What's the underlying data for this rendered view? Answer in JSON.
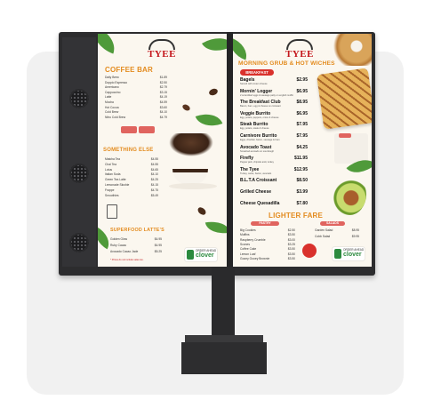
{
  "kiosk": {
    "brand_left": "TYEE",
    "brand_right": "TYEE",
    "left_panel": {
      "coffee_title": "COFFEE BAR",
      "coffee_items": [
        {
          "name": "Daily Brew",
          "price": "$1.89"
        },
        {
          "name": "Doppio Espresso",
          "price": "$2.50"
        },
        {
          "name": "Americano",
          "price": "$2.79"
        },
        {
          "name": "Cappuccino",
          "price": "$3.15"
        },
        {
          "name": "Latte",
          "price": "$4.19"
        },
        {
          "name": "Mocha",
          "price": "$4.59"
        },
        {
          "name": "Hot Cocoa",
          "price": "$3.60"
        },
        {
          "name": "Cold Brew",
          "price": "$4.10"
        },
        {
          "name": "Nitro Cold Brew",
          "price": "$4.79"
        }
      ],
      "else_title": "SOMETHING ELSE",
      "else_items": [
        {
          "name": "Matcha Tea",
          "price": "$4.55"
        },
        {
          "name": "Chai Tea",
          "price": "$4.55"
        },
        {
          "name": "Lotus",
          "price": "$4.65"
        },
        {
          "name": "Italian Soda",
          "price": "$4.10"
        },
        {
          "name": "Green Tea Latte",
          "price": "$4.25"
        },
        {
          "name": "Lemonade Slushie",
          "price": "$4.15"
        },
        {
          "name": "Frappe",
          "price": "$4.75"
        },
        {
          "name": "Smoothies",
          "price": "$5.49"
        }
      ],
      "superfood_title": "SUPERFOOD LATTE'S",
      "superfood_items": [
        {
          "name": "Golden Glow",
          "price": "$4.95"
        },
        {
          "name": "Ruby Cacao",
          "price": "$4.95"
        },
        {
          "name": "Avocado Cacao Jade",
          "price": "$5.25"
        }
      ],
      "superfood_note": "* Prices do not include sales tax."
    },
    "right_panel": {
      "main_title": "MORNING GRUB & HOT WICHES",
      "breakfast_pill": "BREAKFAST",
      "grub_items": [
        {
          "name": "Bagels",
          "price": "$2.95",
          "desc": "Served with cream cheese"
        },
        {
          "name": "Mornin' Logger",
          "price": "$6.95",
          "desc": "2 scrambled eggs & sausage patty on english muffin"
        },
        {
          "name": "The Breakfast Club",
          "price": "$8.95",
          "desc": "Bacon, ham, egg & cheese on croissant"
        },
        {
          "name": "Veggie Burrito",
          "price": "$6.95",
          "desc": "Egg, potato, peppers, onion & cheese"
        },
        {
          "name": "Steak Burrito",
          "price": "$7.95",
          "desc": "Egg, potato, steak & cheese"
        },
        {
          "name": "Carnivore Burrito",
          "price": "$7.95",
          "desc": "Eggs, cheddar, bacon, sausage & ham"
        },
        {
          "name": "Avocado Toast",
          "price": "$4.25",
          "desc": "Smashed avocado on sourdough"
        },
        {
          "name": "Firefly",
          "price": "$11.95",
          "desc": "Pepper jack, chipotle aioli, turkey"
        },
        {
          "name": "The Tyee",
          "price": "$12.95",
          "desc": "Turkey, swiss, bacon, avocado"
        },
        {
          "name": "B.L.T.A Croissant",
          "price": "$8.50",
          "desc": ""
        },
        {
          "name": "Grilled Cheese",
          "price": "$3.99",
          "desc": ""
        },
        {
          "name": "Cheese Quesadilla",
          "price": "$7.80",
          "desc": ""
        }
      ],
      "lighter_title": "LIGHTER FARE",
      "pastry_pill": "PASTRY",
      "salads_pill": "SALADS",
      "pastry_items": [
        {
          "name": "Big Cookies",
          "price": "$2.50"
        },
        {
          "name": "Muffins",
          "price": "$3.50"
        },
        {
          "name": "Raspberry Crumble",
          "price": "$3.00"
        },
        {
          "name": "Scones",
          "price": "$3.25"
        },
        {
          "name": "Coffee Cake",
          "price": "$3.50"
        },
        {
          "name": "Lemon Loaf",
          "price": "$3.50"
        },
        {
          "name": "Gooey Gooey Brownie",
          "price": "$3.50"
        }
      ],
      "salad_items": [
        {
          "name": "Garden Salad",
          "price": "$8.95"
        },
        {
          "name": "Cobb Salad",
          "price": "$9.95"
        }
      ]
    },
    "clover_left": {
      "top": "ORDER AHEAD",
      "brand": "clover"
    },
    "clover_right": {
      "top": "ORDER AHEAD",
      "brand": "clover"
    },
    "colors": {
      "accent": "#e38b1e",
      "red": "#d9312c",
      "green": "#2b8a3e",
      "cabinet": "#2c2c2e",
      "panel": "#fbf7ef"
    }
  }
}
